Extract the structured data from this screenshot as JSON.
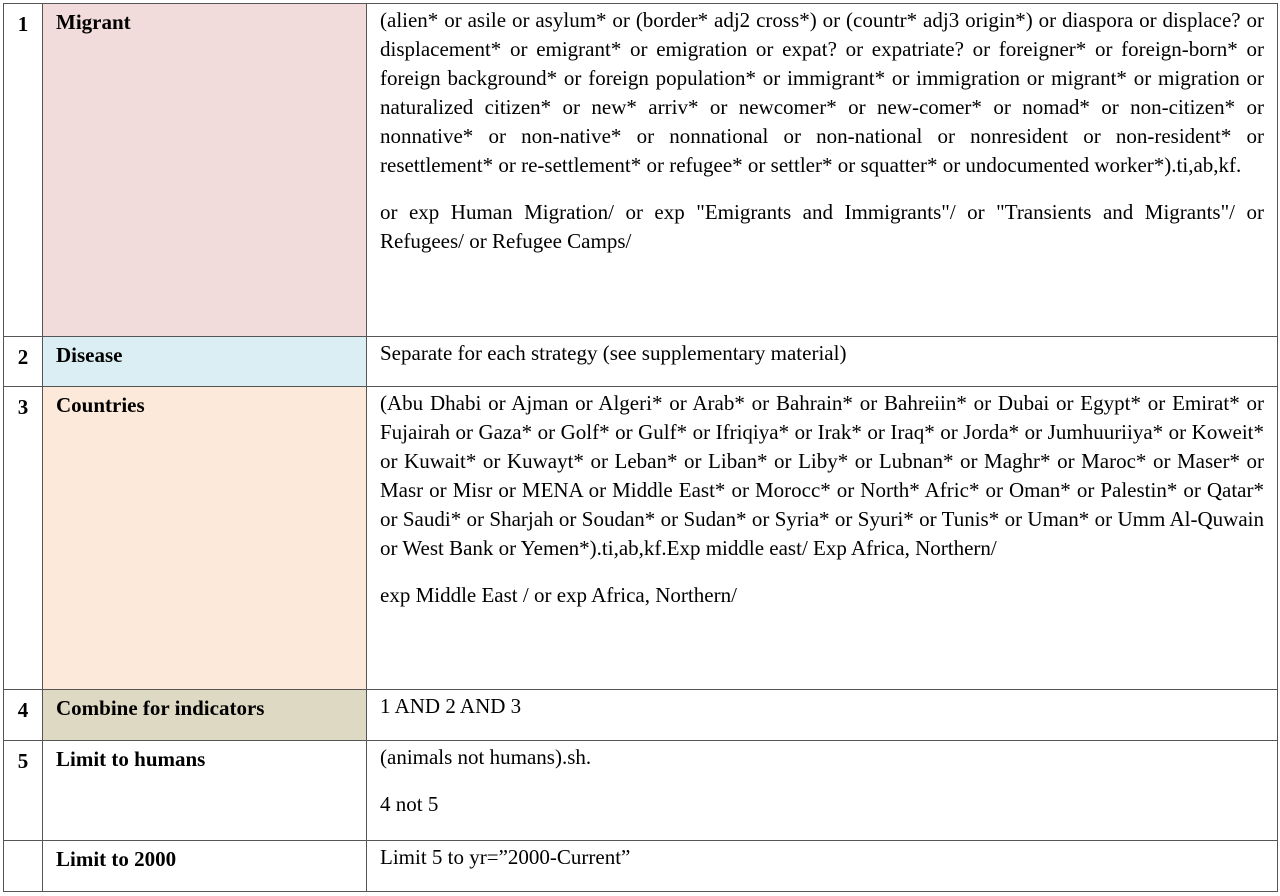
{
  "colors": {
    "migrant": "#f2dcdb",
    "disease": "#daeef3",
    "countries": "#fde9d9",
    "combine": "#ddd9c3",
    "plain": "#ffffff"
  },
  "rows": [
    {
      "num": "1",
      "label": "Migrant",
      "paragraphs": [
        "(alien* or asile or asylum* or (border* adj2 cross*) or (countr* adj3 origin*) or diaspora or displace? or displacement* or emigrant* or emigration or expat? or expatriate? or foreigner* or foreign-born* or foreign background* or foreign population* or immigrant* or immigration or migrant* or migration or naturalized citizen* or new* arriv* or newcomer* or new-comer* or nomad* or non-citizen* or nonnative* or non-native* or nonnational or non-national or nonresident or non-resident* or resettlement* or re-settlement* or refugee* or settler* or squatter* or undocumented worker*).ti,ab,kf.",
        "or exp Human Migration/ or exp \"Emigrants and Immigrants\"/ or \"Transients and Migrants\"/ or Refugees/ or Refugee Camps/"
      ]
    },
    {
      "num": "2",
      "label": "Disease",
      "paragraphs": [
        "Separate for each strategy (see supplementary material)"
      ]
    },
    {
      "num": "3",
      "label": "Countries",
      "paragraphs": [
        "(Abu Dhabi or Ajman or Algeri* or Arab* or Bahrain* or Bahreiin* or Dubai or Egypt* or Emirat* or Fujairah or Gaza* or Golf* or Gulf* or Ifriqiya* or Irak* or Iraq* or Jorda* or Jumhuuriiya* or Koweit* or Kuwait* or Kuwayt* or Leban* or Liban* or Liby* or Lubnan* or Maghr* or Maroc* or Maser* or Masr or Misr or MENA or Middle East* or Morocc* or North* Afric* or Oman* or Palestin* or Qatar* or Saudi* or Sharjah or Soudan* or Sudan* or Syria* or Syuri* or Tunis* or Uman* or Umm Al-Quwain or West Bank or Yemen*).ti,ab,kf.Exp middle east/ Exp Africa, Northern/",
        "exp Middle East / or exp Africa, Northern/"
      ]
    },
    {
      "num": "4",
      "label": "Combine for indicators",
      "paragraphs": [
        "1 AND 2 AND 3"
      ]
    },
    {
      "num": "5",
      "label": "Limit to humans",
      "paragraphs": [
        "(animals not humans).sh.",
        "4 not 5"
      ]
    },
    {
      "num": "",
      "label": "Limit to 2000",
      "paragraphs": [
        "Limit 5 to yr=”2000-Current”"
      ]
    }
  ]
}
